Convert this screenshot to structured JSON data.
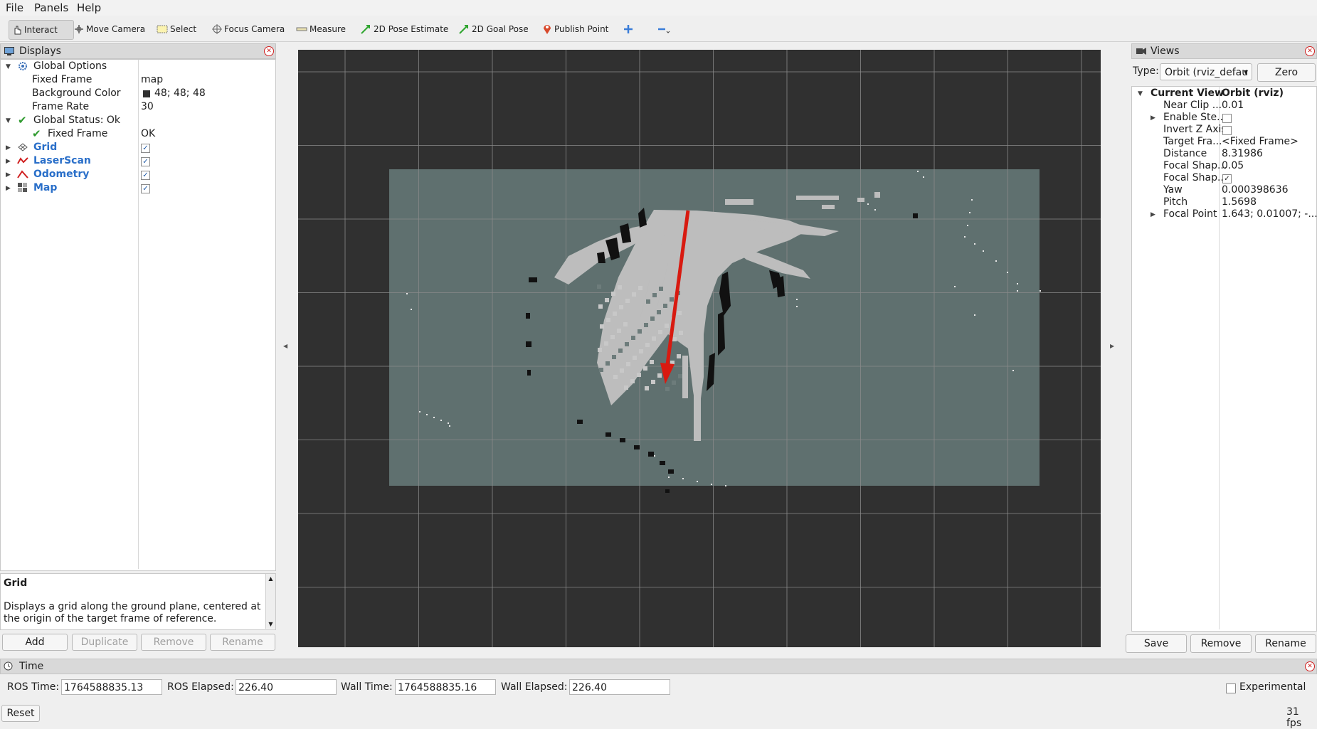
{
  "menu": [
    "File",
    "Panels",
    "Help"
  ],
  "toolbar": {
    "interact": "Interact",
    "move_camera": "Move Camera",
    "select": "Select",
    "focus_camera": "Focus Camera",
    "measure": "Measure",
    "pose_estimate": "2D Pose Estimate",
    "goal_pose": "2D Goal Pose",
    "publish_point": "Publish Point"
  },
  "displays": {
    "title": "Displays",
    "global_options": "Global Options",
    "fixed_frame_label": "Fixed Frame",
    "fixed_frame_value": "map",
    "bg_color_label": "Background Color",
    "bg_color_value": "48; 48; 48",
    "bg_color_swatch": "#303030",
    "frame_rate_label": "Frame Rate",
    "frame_rate_value": "30",
    "global_status": "Global Status: Ok",
    "status_fixed_frame": "Fixed Frame",
    "status_fixed_frame_value": "OK",
    "items": [
      {
        "label": "Grid",
        "checked": true
      },
      {
        "label": "LaserScan",
        "checked": true
      },
      {
        "label": "Odometry",
        "checked": true
      },
      {
        "label": "Map",
        "checked": true
      }
    ],
    "desc_title": "Grid",
    "desc_text": "Displays a grid along the ground plane, centered at the origin of the target frame of reference.",
    "buttons": {
      "add": "Add",
      "duplicate": "Duplicate",
      "remove": "Remove",
      "rename": "Rename"
    }
  },
  "views": {
    "title": "Views",
    "type_label": "Type:",
    "type_value": "Orbit (rviz_defau",
    "zero": "Zero",
    "current_view": "Current View",
    "current_view_value": "Orbit (rviz)",
    "props": [
      {
        "label": "Near Clip ...",
        "value": "0.01"
      },
      {
        "label": "Enable Ste...",
        "value": ""
      },
      {
        "label": "Invert Z Axis",
        "value": ""
      },
      {
        "label": "Target Fra...",
        "value": "<Fixed Frame>"
      },
      {
        "label": "Distance",
        "value": "8.31986"
      },
      {
        "label": "Focal Shap...",
        "value": "0.05"
      },
      {
        "label": "Focal Shap...",
        "value": ""
      },
      {
        "label": "Yaw",
        "value": "0.000398636"
      },
      {
        "label": "Pitch",
        "value": "1.5698"
      },
      {
        "label": "Focal Point",
        "value": "1.643; 0.01007; -..."
      }
    ],
    "buttons": {
      "save": "Save",
      "remove": "Remove",
      "rename": "Rename"
    }
  },
  "time": {
    "title": "Time",
    "ros_time_label": "ROS Time:",
    "ros_time": "1764588835.13",
    "ros_elapsed_label": "ROS Elapsed:",
    "ros_elapsed": "226.40",
    "wall_time_label": "Wall Time:",
    "wall_time": "1764588835.16",
    "wall_elapsed_label": "Wall Elapsed:",
    "wall_elapsed": "226.40",
    "experimental": "Experimental",
    "reset": "Reset",
    "fps": "31 fps"
  }
}
